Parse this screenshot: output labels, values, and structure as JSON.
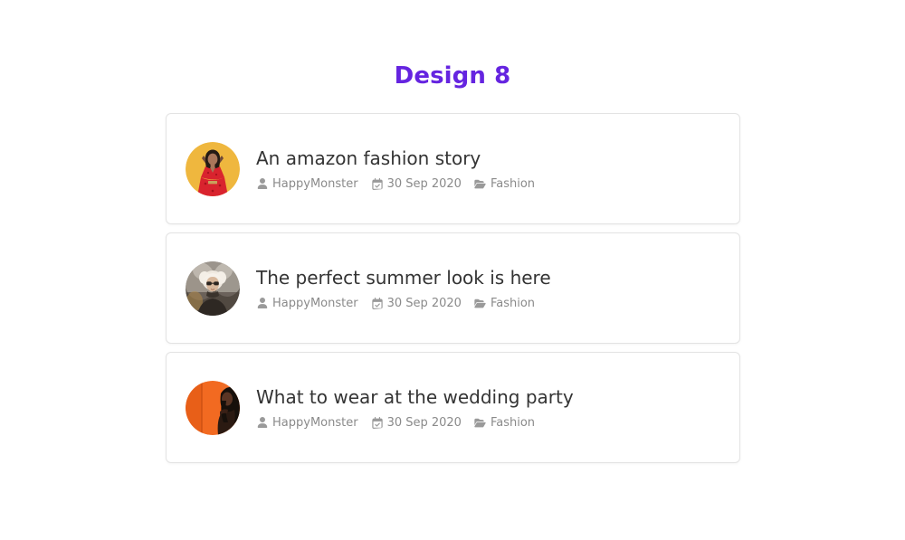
{
  "header": {
    "title": "Design 8",
    "accent_color": "#6524e0"
  },
  "theme": {
    "background": "#ffffff",
    "card_background": "#ffffff",
    "card_border": "#e3e3e3",
    "title_color": "#343434",
    "meta_color": "#8a8a8a"
  },
  "icons": {
    "author": "user-icon",
    "date": "calendar-check-icon",
    "category": "folder-open-icon"
  },
  "posts": [
    {
      "title": "An amazon fashion story",
      "author": "HappyMonster",
      "date": "30 Sep 2020",
      "category": "Fashion",
      "avatar_name": "avatar-woman-red-dress",
      "avatar_bg": "#efb73e",
      "avatar_fg": "#d9232e",
      "avatar_hair": "#241a14"
    },
    {
      "title": "The perfect summer look is here",
      "author": "HappyMonster",
      "date": "30 Sep 2020",
      "category": "Fashion",
      "avatar_name": "avatar-person-light-hair",
      "avatar_bg": "#4b4540",
      "avatar_fg": "#ded6cb",
      "avatar_hair": "#efe9e0"
    },
    {
      "title": "What to wear at the wedding party",
      "author": "HappyMonster",
      "date": "30 Sep 2020",
      "category": "Fashion",
      "avatar_name": "avatar-silhouette-orange",
      "avatar_bg": "#f26a21",
      "avatar_fg": "#2b1a12",
      "avatar_hair": "#120b07"
    }
  ]
}
